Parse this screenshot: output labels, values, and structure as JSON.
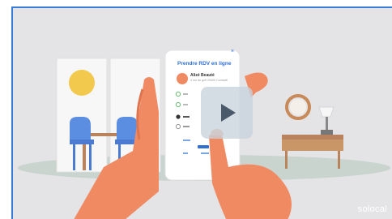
{
  "video": {
    "play_button_icon": "play-icon",
    "watermark": "solocal"
  },
  "phone": {
    "title": "Prendre RDV en ligne",
    "close_icon": "close-icon",
    "provider_name": "Alizé Beauté",
    "provider_subtitle": "4 rue du golf 29400 Cornwall"
  },
  "colors": {
    "accent_blue": "#2f6fd6",
    "background": "#e4e4e6",
    "table": "#b9835d",
    "chair": "#5b8de0",
    "sun": "#f2c94c",
    "skin": "#f08a63"
  }
}
